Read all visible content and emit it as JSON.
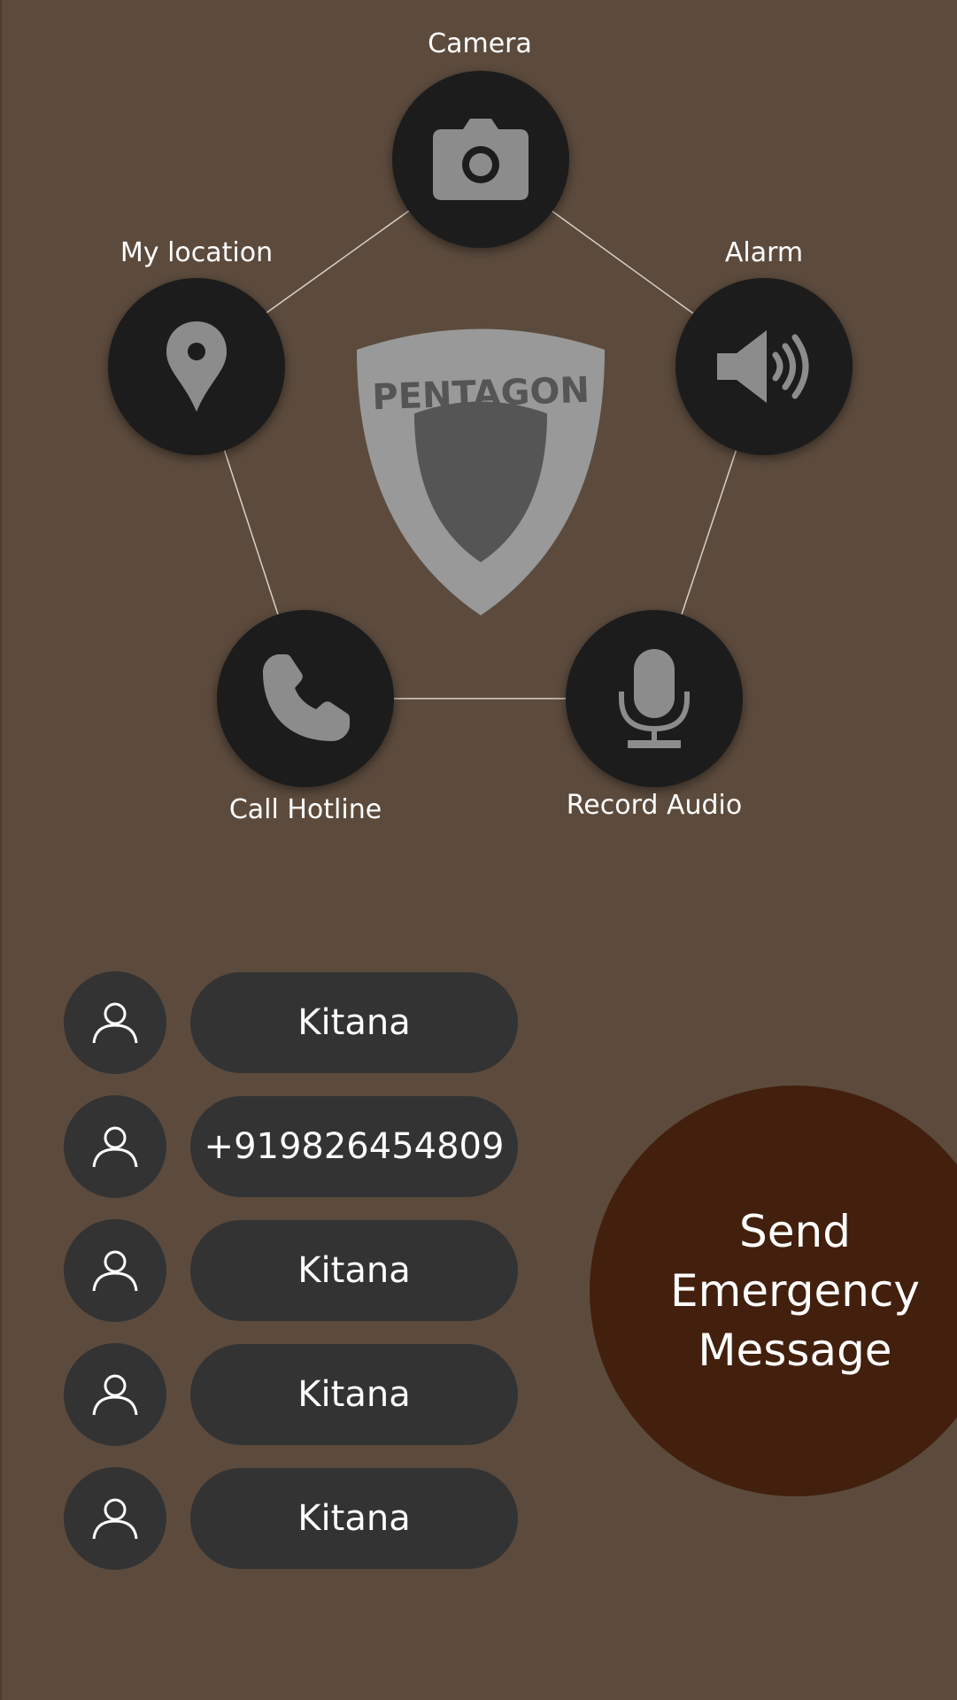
{
  "features": {
    "camera": {
      "label": "Camera",
      "icon": "camera-icon"
    },
    "location": {
      "label": "My location",
      "icon": "map-pin-icon"
    },
    "alarm": {
      "label": "Alarm",
      "icon": "speaker-icon"
    },
    "hotline": {
      "label": "Call Hotline",
      "icon": "phone-icon"
    },
    "audio": {
      "label": "Record Audio",
      "icon": "microphone-icon"
    }
  },
  "logo": {
    "text": "PENTAGON"
  },
  "contacts": [
    {
      "name": "Kitana",
      "icon": "person-icon"
    },
    {
      "name": "+919826454809",
      "icon": "person-icon"
    },
    {
      "name": "Kitana",
      "icon": "person-icon"
    },
    {
      "name": "Kitana",
      "icon": "person-icon"
    },
    {
      "name": "Kitana",
      "icon": "person-icon"
    }
  ],
  "send_button": {
    "line1": "Send",
    "line2": "Emergency",
    "line3": "Message"
  },
  "colors": {
    "background": "#5c4b3d",
    "feature_button": "#1c1c1c",
    "icon_gray": "#8c8c8c",
    "contact_fill": "#333333",
    "send_button": "#42200d"
  }
}
